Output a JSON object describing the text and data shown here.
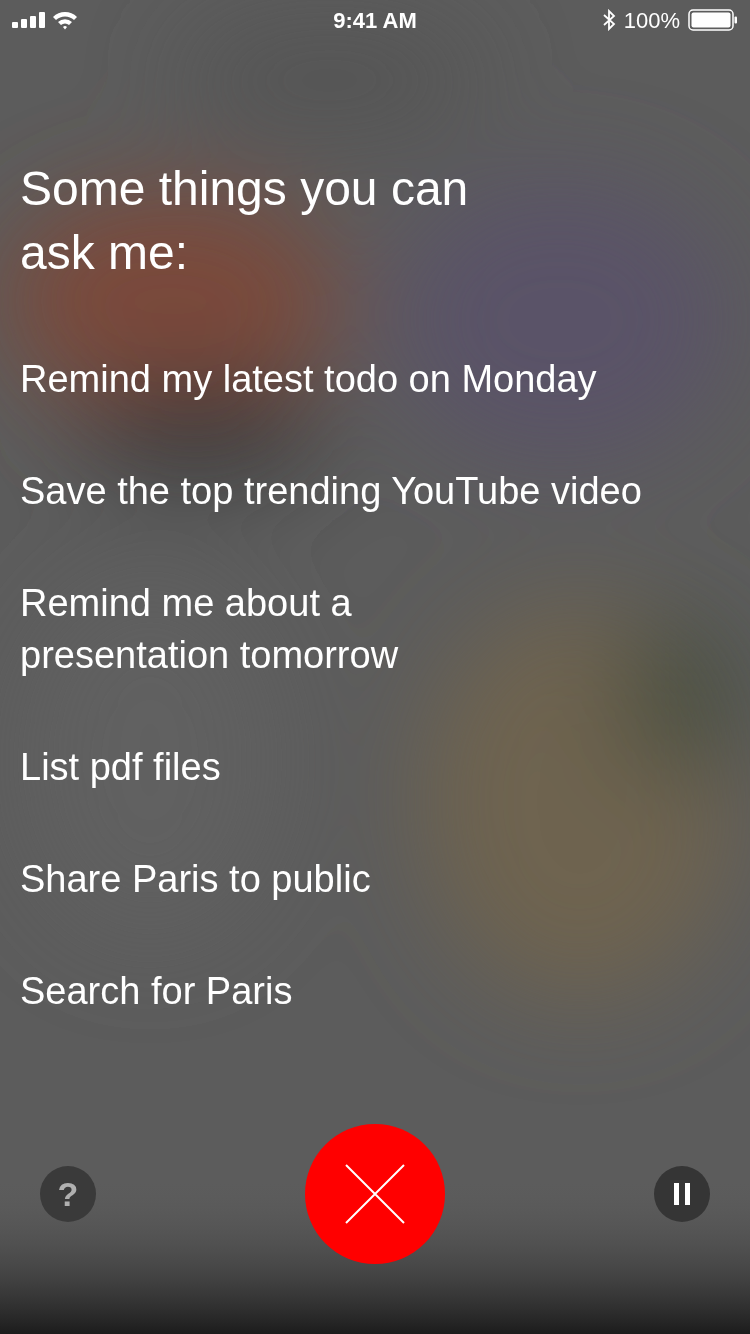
{
  "status_bar": {
    "time": "9:41 AM",
    "battery": "100%"
  },
  "heading": "Some things you can\nask me:",
  "suggestions": [
    "Remind my latest todo on Monday",
    "Save the top trending YouTube video",
    "Remind me about a\npresentation tomorrow",
    "List pdf files",
    "Share Paris to public",
    "Search for Paris"
  ],
  "help_button": {
    "label": "?"
  }
}
